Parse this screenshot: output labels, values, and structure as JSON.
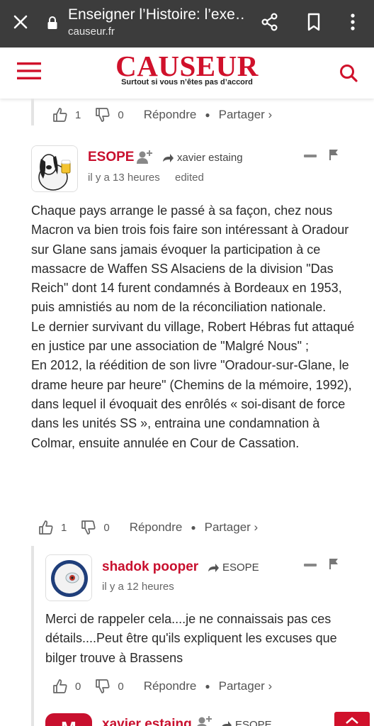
{
  "browser": {
    "title": "Enseigner l’Histoire: l’exe…",
    "domain": "causeur.fr"
  },
  "site": {
    "logo": "CAUSEUR",
    "tagline": "Surtout si vous n’êtes pas d’accord"
  },
  "top_actions": {
    "likes": "1",
    "dislikes": "0",
    "reply_label": "Répondre",
    "share_label": "Partager ›"
  },
  "comments": [
    {
      "author": "ESOPE",
      "reply_to": "xavier estaing",
      "time": "il y a 13 heures",
      "edited": "edited",
      "body": [
        "Chaque pays arrange le passé à sa façon, chez nous Macron va bien trois fois faire son intéressant à Oradour sur Glane sans jamais évoquer la participation à ce massacre de Waffen SS Alsaciens de la division \"Das Reich\" dont 14 furent condamnés à Bordeaux en 1953, puis amnistiés au nom de la réconciliation nationale.",
        "Le dernier survivant du village, Robert Hébras fut attaqué en justice par une association de \"Malgré Nous\" ;",
        "En 2012, la réédition de son livre \"Oradour-sur-Glane, le drame heure par heure\" (Chemins de la mémoire, 1992), dans lequel il évoquait des enrôlés « soi-disant de force dans les unités SS », entraina une condamnation à Colmar, ensuite annulée en Cour de Cassation."
      ],
      "likes": "1",
      "dislikes": "0",
      "reply_label": "Répondre",
      "share_label": "Partager ›"
    },
    {
      "author": "shadok pooper",
      "reply_to": "ESOPE",
      "time": "il y a 12 heures",
      "body": [
        "Merci de rappeler cela....je ne connaissais pas ces détails....Peut être qu'ils expliquent les excuses que bilger trouve à Brassens"
      ],
      "likes": "0",
      "dislikes": "0",
      "reply_label": "Répondre",
      "share_label": "Partager ›"
    },
    {
      "author": "xavier estaing",
      "reply_to": "ESOPE",
      "avatar_letter": "M"
    }
  ],
  "colors": {
    "brand": "#d0112b",
    "topbar": "#3c3c3c"
  }
}
